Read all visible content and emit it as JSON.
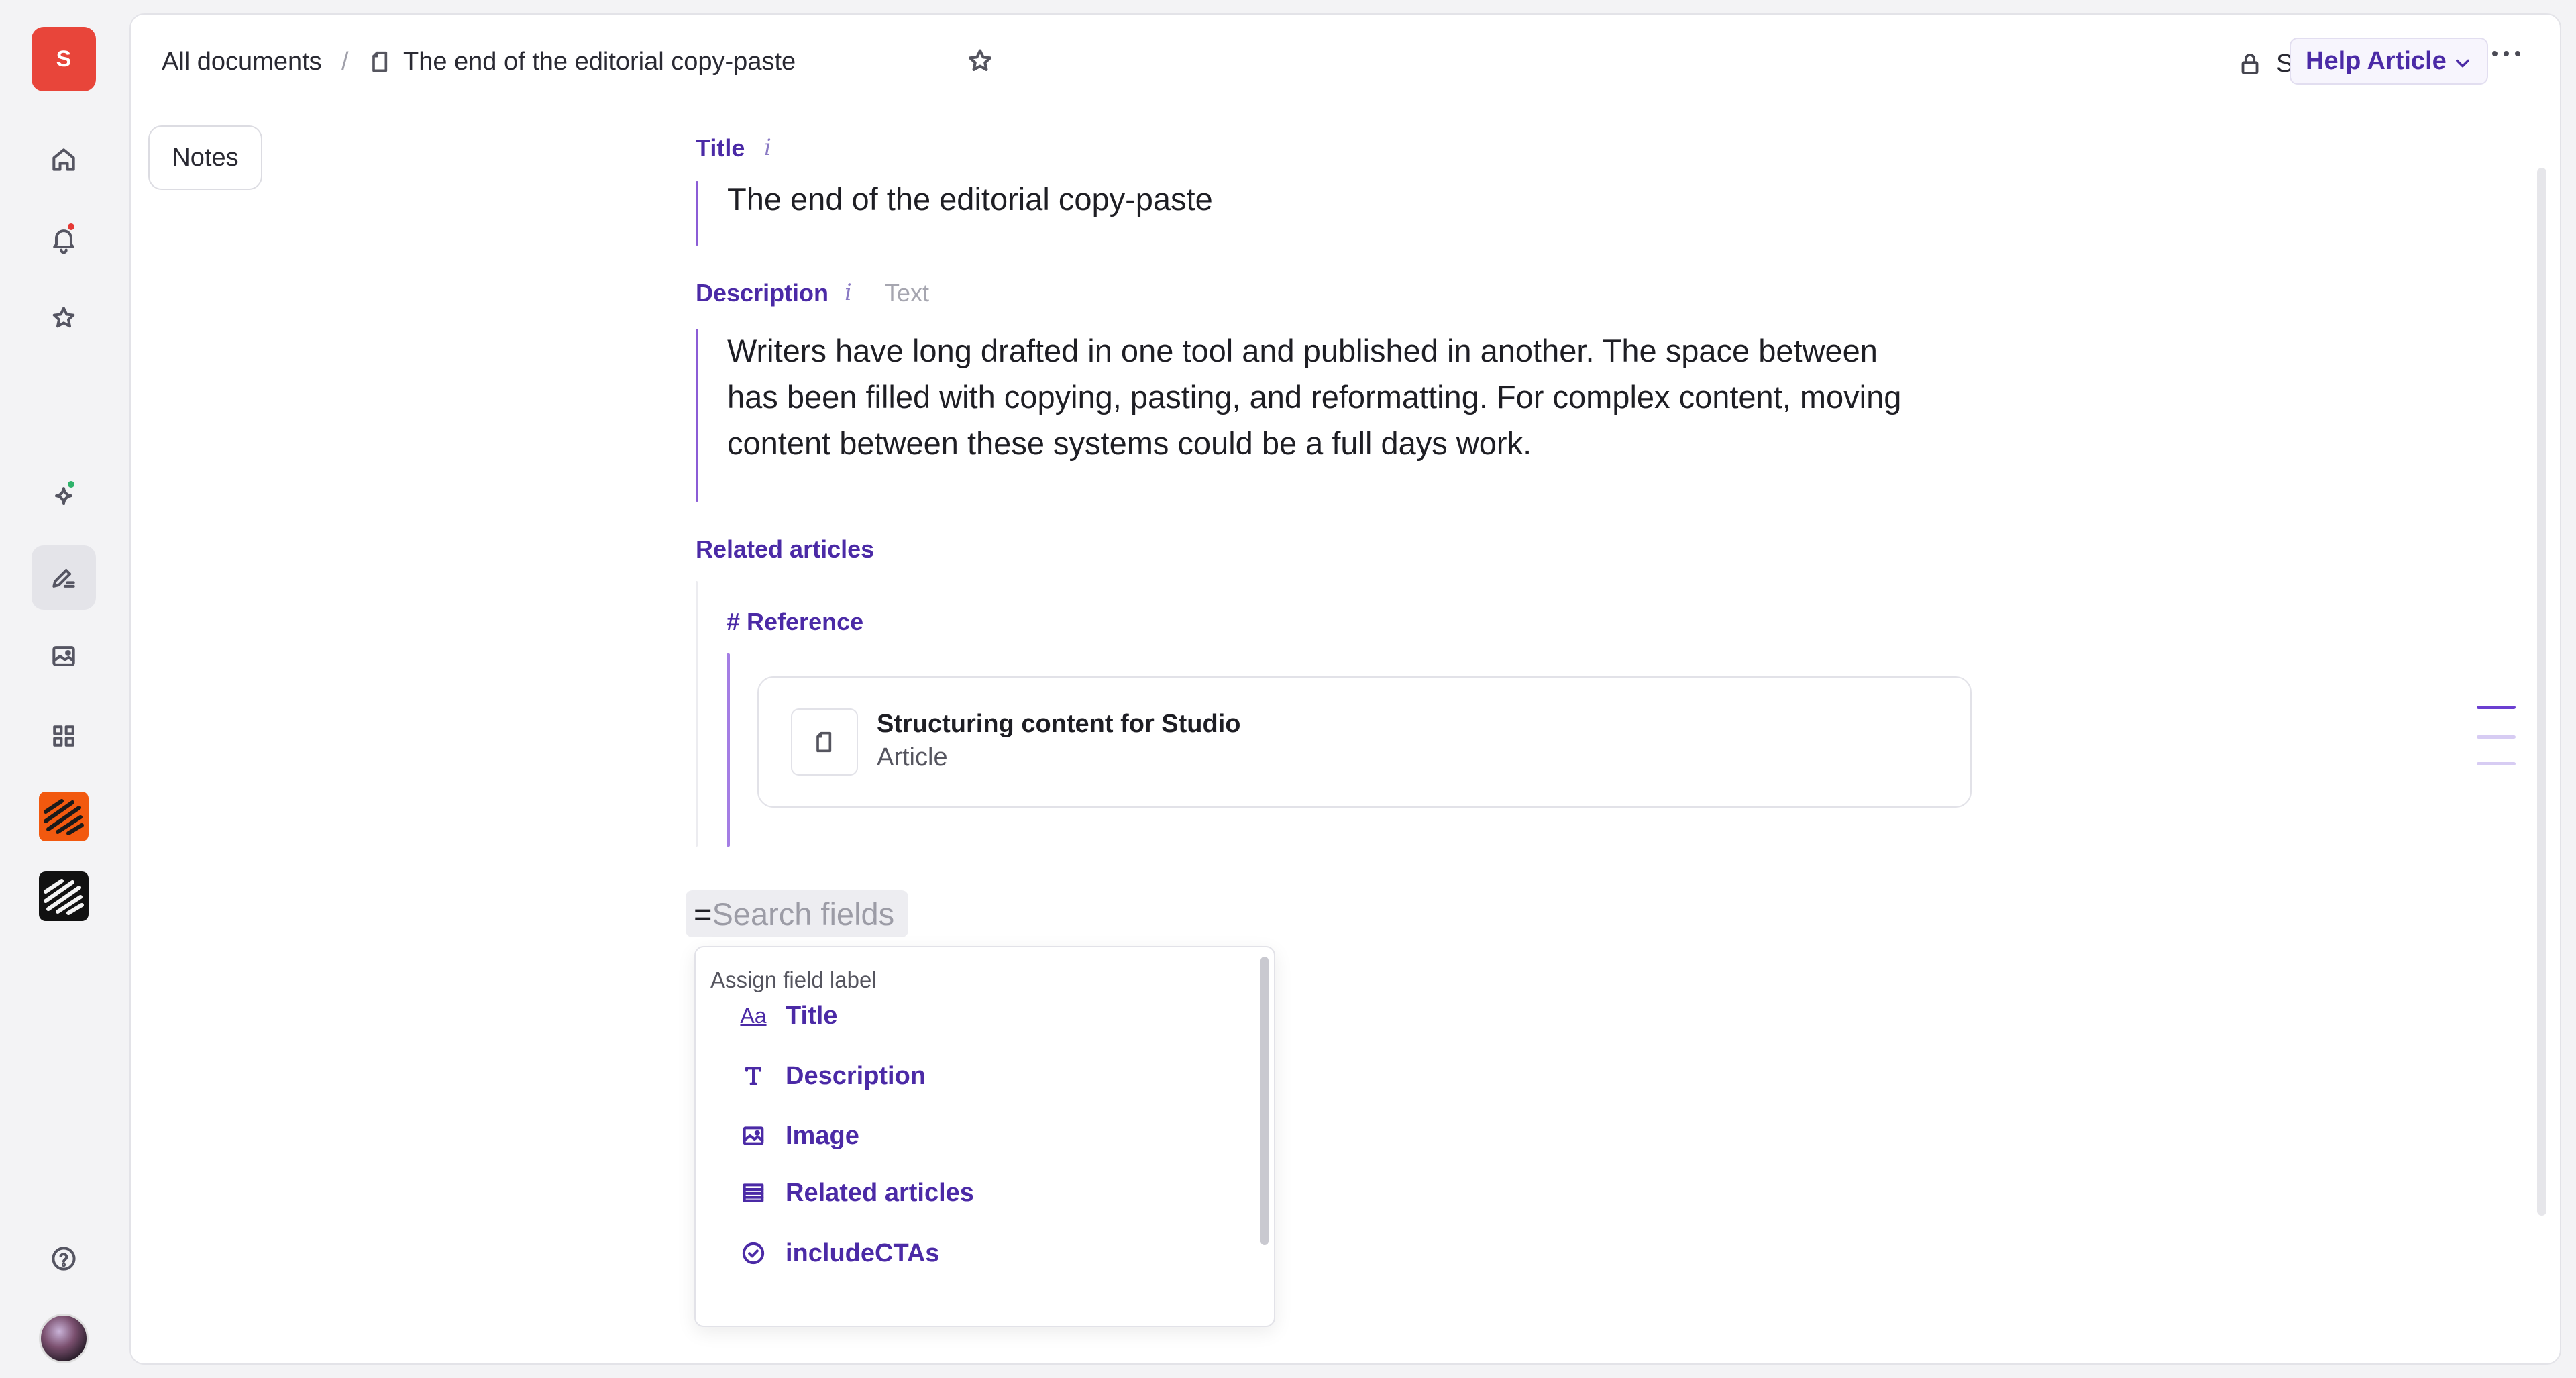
{
  "workspace": {
    "initial": "S",
    "color": "#e8453a"
  },
  "rail": {
    "items": [
      "home-icon",
      "bell-icon",
      "star-icon",
      "sparkle-icon",
      "pen-icon",
      "image-icon",
      "grid-icon",
      "app-tile-orange",
      "app-tile-black",
      "help-icon",
      "avatar"
    ]
  },
  "breadcrumb": {
    "root": "All documents",
    "separator": "/",
    "current": "The end of the editorial copy-paste"
  },
  "header": {
    "share_label": "Share",
    "type_label": "Help Article"
  },
  "notes_label": "Notes",
  "fields": {
    "title": {
      "label": "Title",
      "info": "i",
      "value": "The end of the editorial copy-paste"
    },
    "description": {
      "label": "Description",
      "info": "i",
      "type": "Text",
      "lines": [
        "Writers have long drafted in one tool and published in another. The space between",
        "has been filled with copying, pasting, and reformatting. For complex content, moving",
        "content between these systems could be a full days work."
      ]
    },
    "related": {
      "label": "Related articles",
      "block_label": "# Reference",
      "card_title": "Structuring content for Studio",
      "card_subtitle": "Article"
    }
  },
  "search": {
    "prefix": "=",
    "placeholder": "Search fields"
  },
  "dropdown": {
    "heading": "Assign field label",
    "items": [
      {
        "icon": "text-aa-icon",
        "glyph": "Aa",
        "label": "Title"
      },
      {
        "icon": "text-t-icon",
        "label": "Description"
      },
      {
        "icon": "image-icon",
        "label": "Image"
      },
      {
        "icon": "list-icon",
        "label": "Related articles"
      },
      {
        "icon": "check-circle-icon",
        "label": "includeCTAs"
      }
    ]
  },
  "colors": {
    "accent": "#4b2aa6",
    "field_bar": "#8b5cd6",
    "notification_dot": "#e53935",
    "ai_dot": "#2fb36b"
  }
}
